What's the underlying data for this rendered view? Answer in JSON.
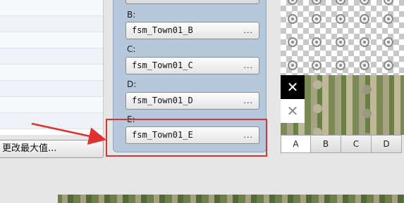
{
  "left_panel": {
    "button_label": "更改最大值..."
  },
  "fields": [
    {
      "label": "B:",
      "value": "fsm_Town01_B",
      "browse": "..."
    },
    {
      "label": "C:",
      "value": "fsm_Town01_C",
      "browse": "..."
    },
    {
      "label": "D:",
      "value": "fsm_Town01_D",
      "browse": "..."
    },
    {
      "label": "E:",
      "value": "fsm_Town01_E",
      "browse": "..."
    }
  ],
  "palette": {
    "tabs": [
      "A",
      "B",
      "C",
      "D"
    ],
    "selected_tab": "A",
    "erase_symbol": "✕"
  },
  "annotation": {
    "color": "#e03030"
  }
}
